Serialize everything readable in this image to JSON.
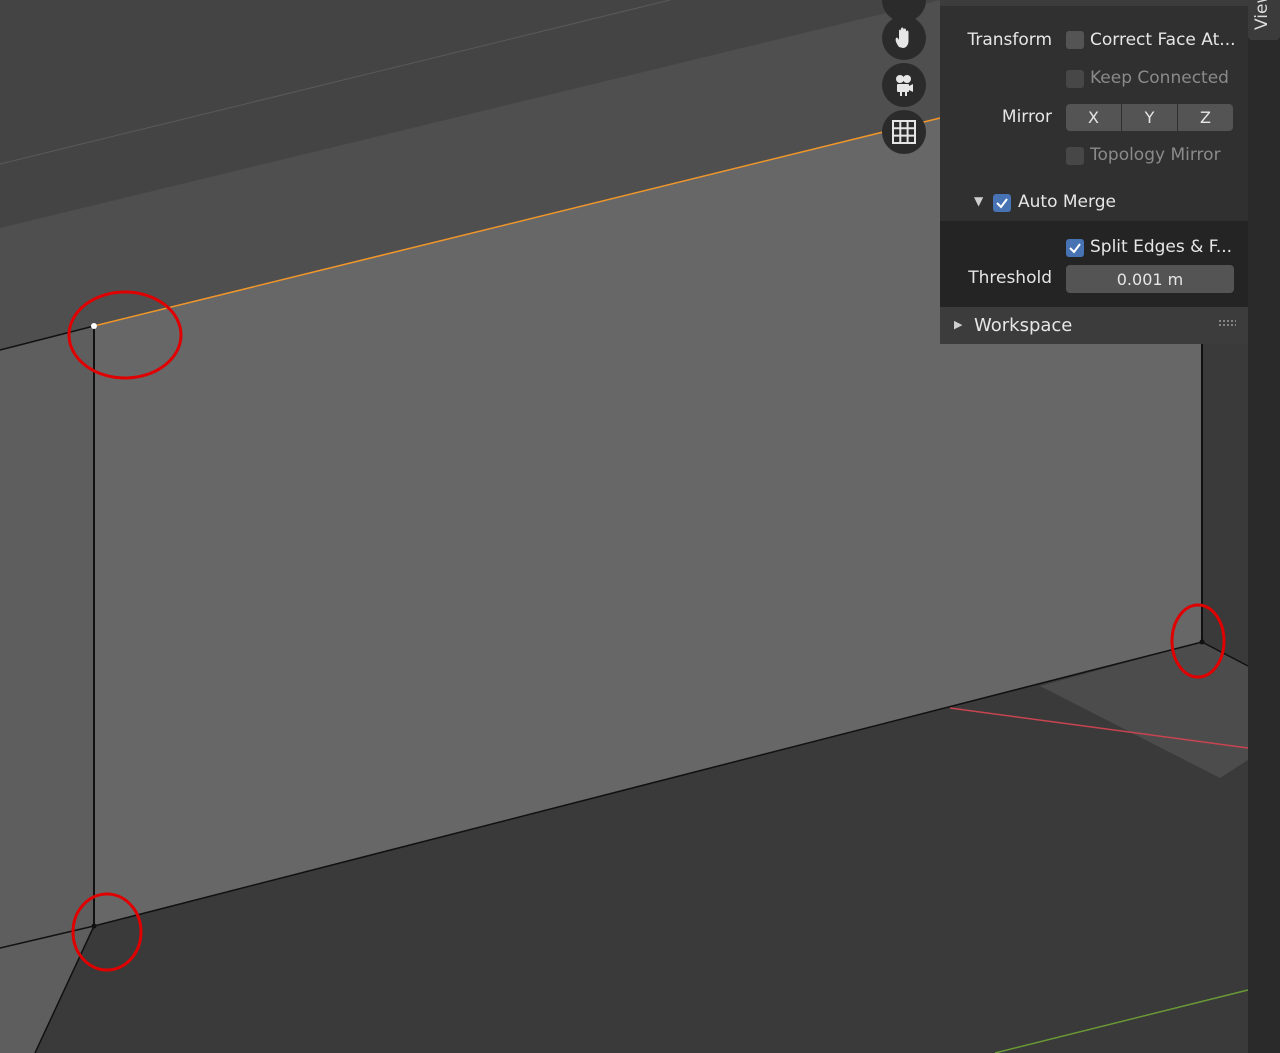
{
  "panel": {
    "transform_label": "Transform",
    "correct_face_label": "Correct Face At...",
    "keep_connected_label": "Keep Connected",
    "mirror_label": "Mirror",
    "mirror_axes": [
      "X",
      "Y",
      "Z"
    ],
    "topology_mirror_label": "Topology Mirror",
    "auto_merge_label": "Auto Merge",
    "split_edges_label": "Split Edges & F...",
    "threshold_label": "Threshold",
    "threshold_value": "0.001 m",
    "workspace_label": "Workspace"
  },
  "side_tab": {
    "label": "View"
  },
  "nav_icons": [
    "pan-hand-icon",
    "camera-icon",
    "grid-icon"
  ],
  "colors": {
    "selected_edge": "#f0962a",
    "annotation_circle": "#e00000",
    "checkbox_checked": "#4772b3",
    "x_axis": "#c84450",
    "y_axis": "#6a9a34"
  }
}
